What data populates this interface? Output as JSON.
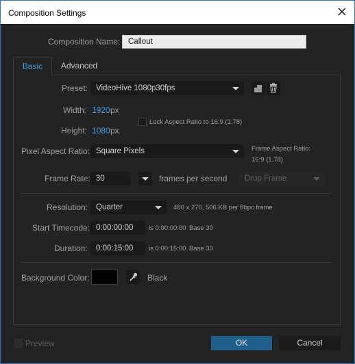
{
  "window": {
    "title": "Composition Settings"
  },
  "comp_name": {
    "label": "Composition Name:",
    "value": "Callout"
  },
  "tabs": [
    {
      "label": "Basic"
    },
    {
      "label": "Advanced"
    }
  ],
  "preset": {
    "label": "Preset:",
    "value": "VideoHive 1080p30fps"
  },
  "width": {
    "label": "Width:",
    "value": "1920",
    "unit": "px"
  },
  "height": {
    "label": "Height:",
    "value": "1080",
    "unit": "px"
  },
  "lock_aspect": {
    "label": "Lock Aspect Ratio to 16:9 (1,78)",
    "checked": false
  },
  "pixel_aspect": {
    "label": "Pixel Aspect Ratio:",
    "value": "Square Pixels"
  },
  "frame_aspect": {
    "line1": "Frame Aspect Ratio:",
    "line2": "16:9 (1,78)"
  },
  "frame_rate": {
    "label": "Frame Rate:",
    "value": "30",
    "unit": "frames per second",
    "drop_frame": "Drop Frame"
  },
  "resolution": {
    "label": "Resolution:",
    "value": "Quarter",
    "info": "480 x 270, 506 KB per 8bpc frame"
  },
  "start_timecode": {
    "label": "Start Timecode:",
    "value": "0:00:00:00",
    "info_is": "is 0:00:00:00",
    "info_base": "Base 30"
  },
  "duration": {
    "label": "Duration:",
    "value": "0:00:15:00",
    "info_is": "is 0:00:15:00",
    "info_base": "Base 30"
  },
  "background": {
    "label": "Background Color:",
    "color_name": "Black",
    "color": "#000000"
  },
  "footer": {
    "preview_label": "Preview",
    "ok_label": "OK",
    "cancel_label": "Cancel"
  },
  "icons": [
    "close-icon",
    "save-preset-icon",
    "trash-icon",
    "eyedropper-icon",
    "chevron-down-icon"
  ],
  "colors": {
    "accent": "#3d9ee8",
    "ok_button": "#1f5f8b",
    "window_border": "#2c72c7"
  }
}
